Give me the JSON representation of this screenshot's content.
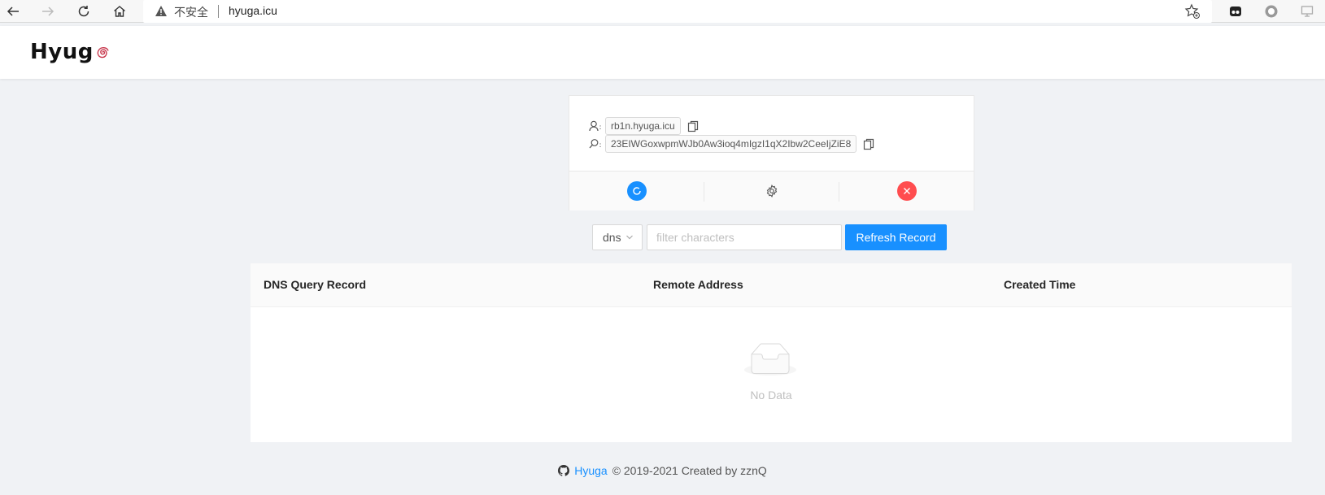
{
  "browser": {
    "security_label": "不安全",
    "url": "hyuga.icu"
  },
  "header": {
    "logo_text": "Hyug"
  },
  "card": {
    "domain": "rb1n.hyuga.icu",
    "token": "23EIWGoxwpmWJb0Aw3ioq4mIgzI1qX2Ibw2CeeIjZiE8"
  },
  "filter": {
    "select_value": "dns",
    "placeholder": "filter characters",
    "refresh_label": "Refresh Record"
  },
  "table": {
    "columns": [
      "DNS Query Record",
      "Remote Address",
      "Created Time"
    ],
    "rows": [],
    "empty_text": "No Data"
  },
  "footer": {
    "link_text": "Hyuga",
    "copyright": "© 2019-2021 Created by zznQ"
  },
  "colors": {
    "primary": "#1890ff",
    "danger": "#ff4d4f",
    "background": "#f0f2f5"
  }
}
